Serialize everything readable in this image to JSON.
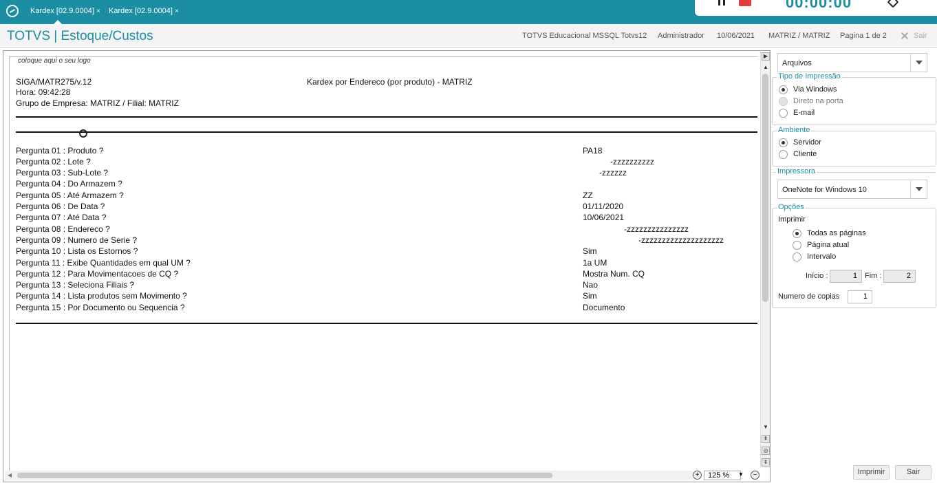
{
  "tabs": [
    {
      "label": "Kardex [02.9.0004]",
      "close": "×"
    },
    {
      "label": "Kardex [02.9.0004]",
      "close": "×"
    }
  ],
  "recorder": {
    "time": "00:00:00"
  },
  "header": {
    "title": "TOTVS | Estoque/Custos",
    "environment": "TOTVS Educacional MSSQL Totvs12",
    "user": "Administrador",
    "date": "10/06/2021",
    "branch": "MATRIZ / MATRIZ",
    "page": "Pagina 1 de 2",
    "exit": "Sair"
  },
  "report": {
    "logo_text": "coloque aqui o seu logo",
    "program": "SIGA/MATR275/v.12",
    "title": "Kardex por Endereco (por produto) - MATRIZ",
    "time": "Hora: 09:42:28",
    "group": "Grupo de Empresa: MATRIZ / Filial: MATRIZ",
    "params": [
      {
        "q": "Pergunta 01 : Produto ?",
        "v": "PA18"
      },
      {
        "q": "Pergunta 02 : Lote ?",
        "v": "-zzzzzzzzzz"
      },
      {
        "q": "Pergunta 03 : Sub-Lote ?",
        "v": "-zzzzzz"
      },
      {
        "q": "Pergunta 04 : Do Armazem ?",
        "v": ""
      },
      {
        "q": "Pergunta 05 : Até Armazem ?",
        "v": "ZZ"
      },
      {
        "q": "Pergunta 06 : De  Data ?",
        "v": "01/11/2020"
      },
      {
        "q": "Pergunta 07 : Até Data ?",
        "v": "10/06/2021"
      },
      {
        "q": "Pergunta 08 : Endereco ?",
        "v": "-zzzzzzzzzzzzzzz"
      },
      {
        "q": "Pergunta 09 : Numero de Serie ?",
        "v": "-zzzzzzzzzzzzzzzzzzzz"
      },
      {
        "q": "Pergunta 10 : Lista os Estornos ?",
        "v": "Sim"
      },
      {
        "q": "Pergunta 11 : Exibe Quantidades em qual UM ?",
        "v": "1a UM"
      },
      {
        "q": "Pergunta 12 : Para Movimentacoes de CQ ?",
        "v": "Mostra Num. CQ"
      },
      {
        "q": "Pergunta 13 : Seleciona Filiais ?",
        "v": "Nao"
      },
      {
        "q": "Pergunta 14 : Lista produtos sem Movimento ?",
        "v": "Sim"
      },
      {
        "q": "Pergunta 15 : Por Documento ou Sequencia ?",
        "v": "Documento"
      }
    ]
  },
  "zoom": {
    "value": "125 %"
  },
  "options": {
    "output_combo": "Arquivos",
    "print_type": {
      "title": "Tipo de Impressão",
      "items": [
        "Via Windows",
        "Direto na porta",
        "E-mail"
      ]
    },
    "environment": {
      "title": "Ambiente",
      "items": [
        "Servidor",
        "Cliente"
      ]
    },
    "printer": {
      "title": "Impressora",
      "value": "OneNote for Windows 10"
    },
    "opcoes": {
      "title": "Opções",
      "print_label": "Imprimir",
      "items": [
        "Todas as páginas",
        "Página atual",
        "Intervalo"
      ],
      "start_label": "Início :",
      "start_value": "1",
      "end_label": "Fim :",
      "end_value": "2",
      "copies_label": "Numero de copias",
      "copies_value": "1"
    },
    "print_button": "Imprimir",
    "exit_button": "Sair"
  }
}
